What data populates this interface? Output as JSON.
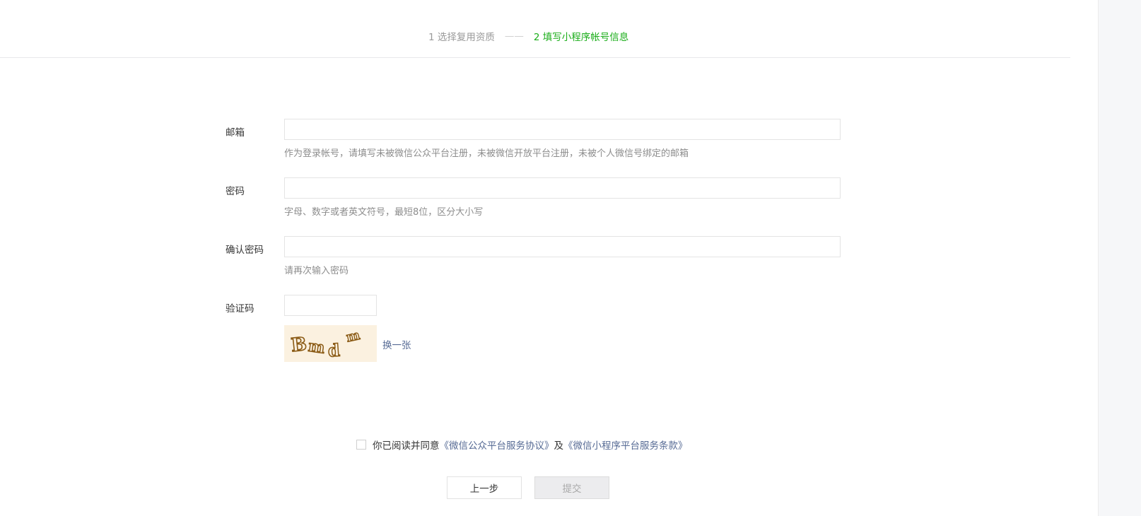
{
  "steps": {
    "step1": "1 选择复用资质",
    "separator": "——",
    "step2": "2 填写小程序帐号信息"
  },
  "form": {
    "email": {
      "label": "邮箱",
      "value": "",
      "tip": "作为登录帐号，请填写未被微信公众平台注册，未被微信开放平台注册，未被个人微信号绑定的邮箱"
    },
    "password": {
      "label": "密码",
      "value": "",
      "tip": "字母、数字或者英文符号，最短8位，区分大小写"
    },
    "confirm_password": {
      "label": "确认密码",
      "value": "",
      "tip": "请再次输入密码"
    },
    "captcha": {
      "label": "验证码",
      "value": "",
      "image_text": "Bmdm",
      "refresh_label": "换一张"
    }
  },
  "agreement": {
    "checked": false,
    "text": "你已阅读并同意",
    "link1": "《微信公众平台服务协议》",
    "conjunction": "及",
    "link2": "《微信小程序平台服务条款》"
  },
  "buttons": {
    "prev": "上一步",
    "submit": "提交"
  },
  "colors": {
    "active_step": "#1aad19",
    "link": "#576b95",
    "muted": "#8d8d8d"
  }
}
